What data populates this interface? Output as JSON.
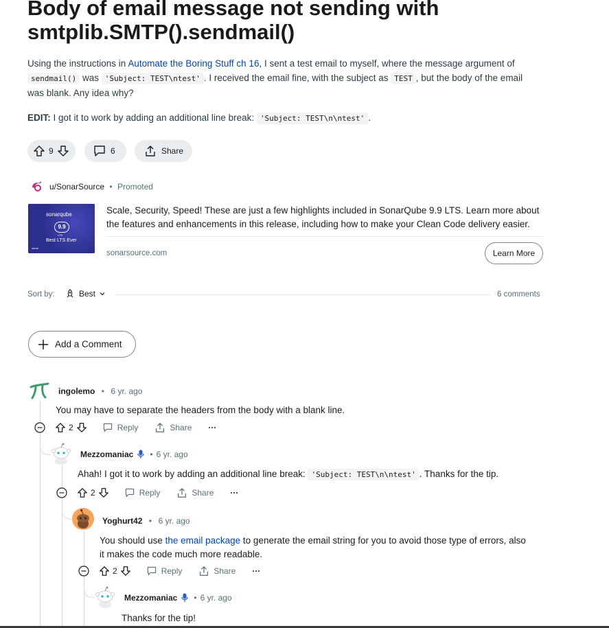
{
  "post": {
    "title": "Body of email message not sending with smtplib.SMTP().sendmail()",
    "para1_a": "Using the instructions in ",
    "para1_link": "Automate the Boring Stuff ch 16",
    "para1_b": ", I sent a test email to myself, where the message argument of",
    "para1_code1": "sendmail()",
    "para1_c": " was ",
    "para1_code2": "'Subject: TEST\\ntest'",
    "para1_d": ". I received the email fine, with the subject as ",
    "para1_code3": "TEST",
    "para1_e": ", but the body of the email",
    "para1_f": "was blank. Any idea why?",
    "edit_label": "EDIT:",
    "edit_text": " I got it to work by adding an additional line break: ",
    "edit_code": "'Subject: TEST\\n\\ntest'",
    "edit_end": "."
  },
  "actions": {
    "votes": "9",
    "comments": "6",
    "share": "Share"
  },
  "ad": {
    "user": "u/SonarSource",
    "promoted": "Promoted",
    "thumb_brand": "sonarqube",
    "thumb_version": "9.9",
    "thumb_lts": "LTS",
    "thumb_tagline": "Best LTS Ever",
    "thumb_footer": "sonar",
    "text": "Scale, Security, Speed! These are just a few highlights included in SonarQube 9.9 LTS. Learn more about the features and enhancements in this release, including how to make your Clean Code delivery easier.",
    "domain": "sonarsource.com",
    "cta": "Learn More"
  },
  "sort": {
    "label": "Sort by:",
    "value": "Best",
    "count": "6 comments"
  },
  "add_comment": "Add a Comment",
  "comments": [
    {
      "user": "ingolemo",
      "time": "6 yr. ago",
      "text": "You may have to separate the headers from the body with a blank line.",
      "votes": "2",
      "reply": "Reply",
      "share": "Share"
    },
    {
      "user": "Mezzomaniac",
      "time": "6 yr. ago",
      "text_a": "Ahah! I got it to work by adding an additional line break: ",
      "code": "'Subject: TEST\\n\\ntest'",
      "text_b": ". Thanks for the tip.",
      "votes": "2",
      "reply": "Reply",
      "share": "Share"
    },
    {
      "user": "Yoghurt42",
      "time": "6 yr. ago",
      "text_a": "You should use ",
      "link": "the email package",
      "text_b": " to generate the email string for you to avoid those type of errors, also",
      "text_c": "it makes the code much more readable.",
      "votes": "2",
      "reply": "Reply",
      "share": "Share"
    },
    {
      "user": "Mezzomaniac",
      "time": "6 yr. ago",
      "text": "Thanks for the tip!"
    }
  ],
  "colors": {
    "link": "#0045ac",
    "muted": "#576f76",
    "pill": "#eaedef",
    "sonar_bg": "#2c2e8e"
  }
}
